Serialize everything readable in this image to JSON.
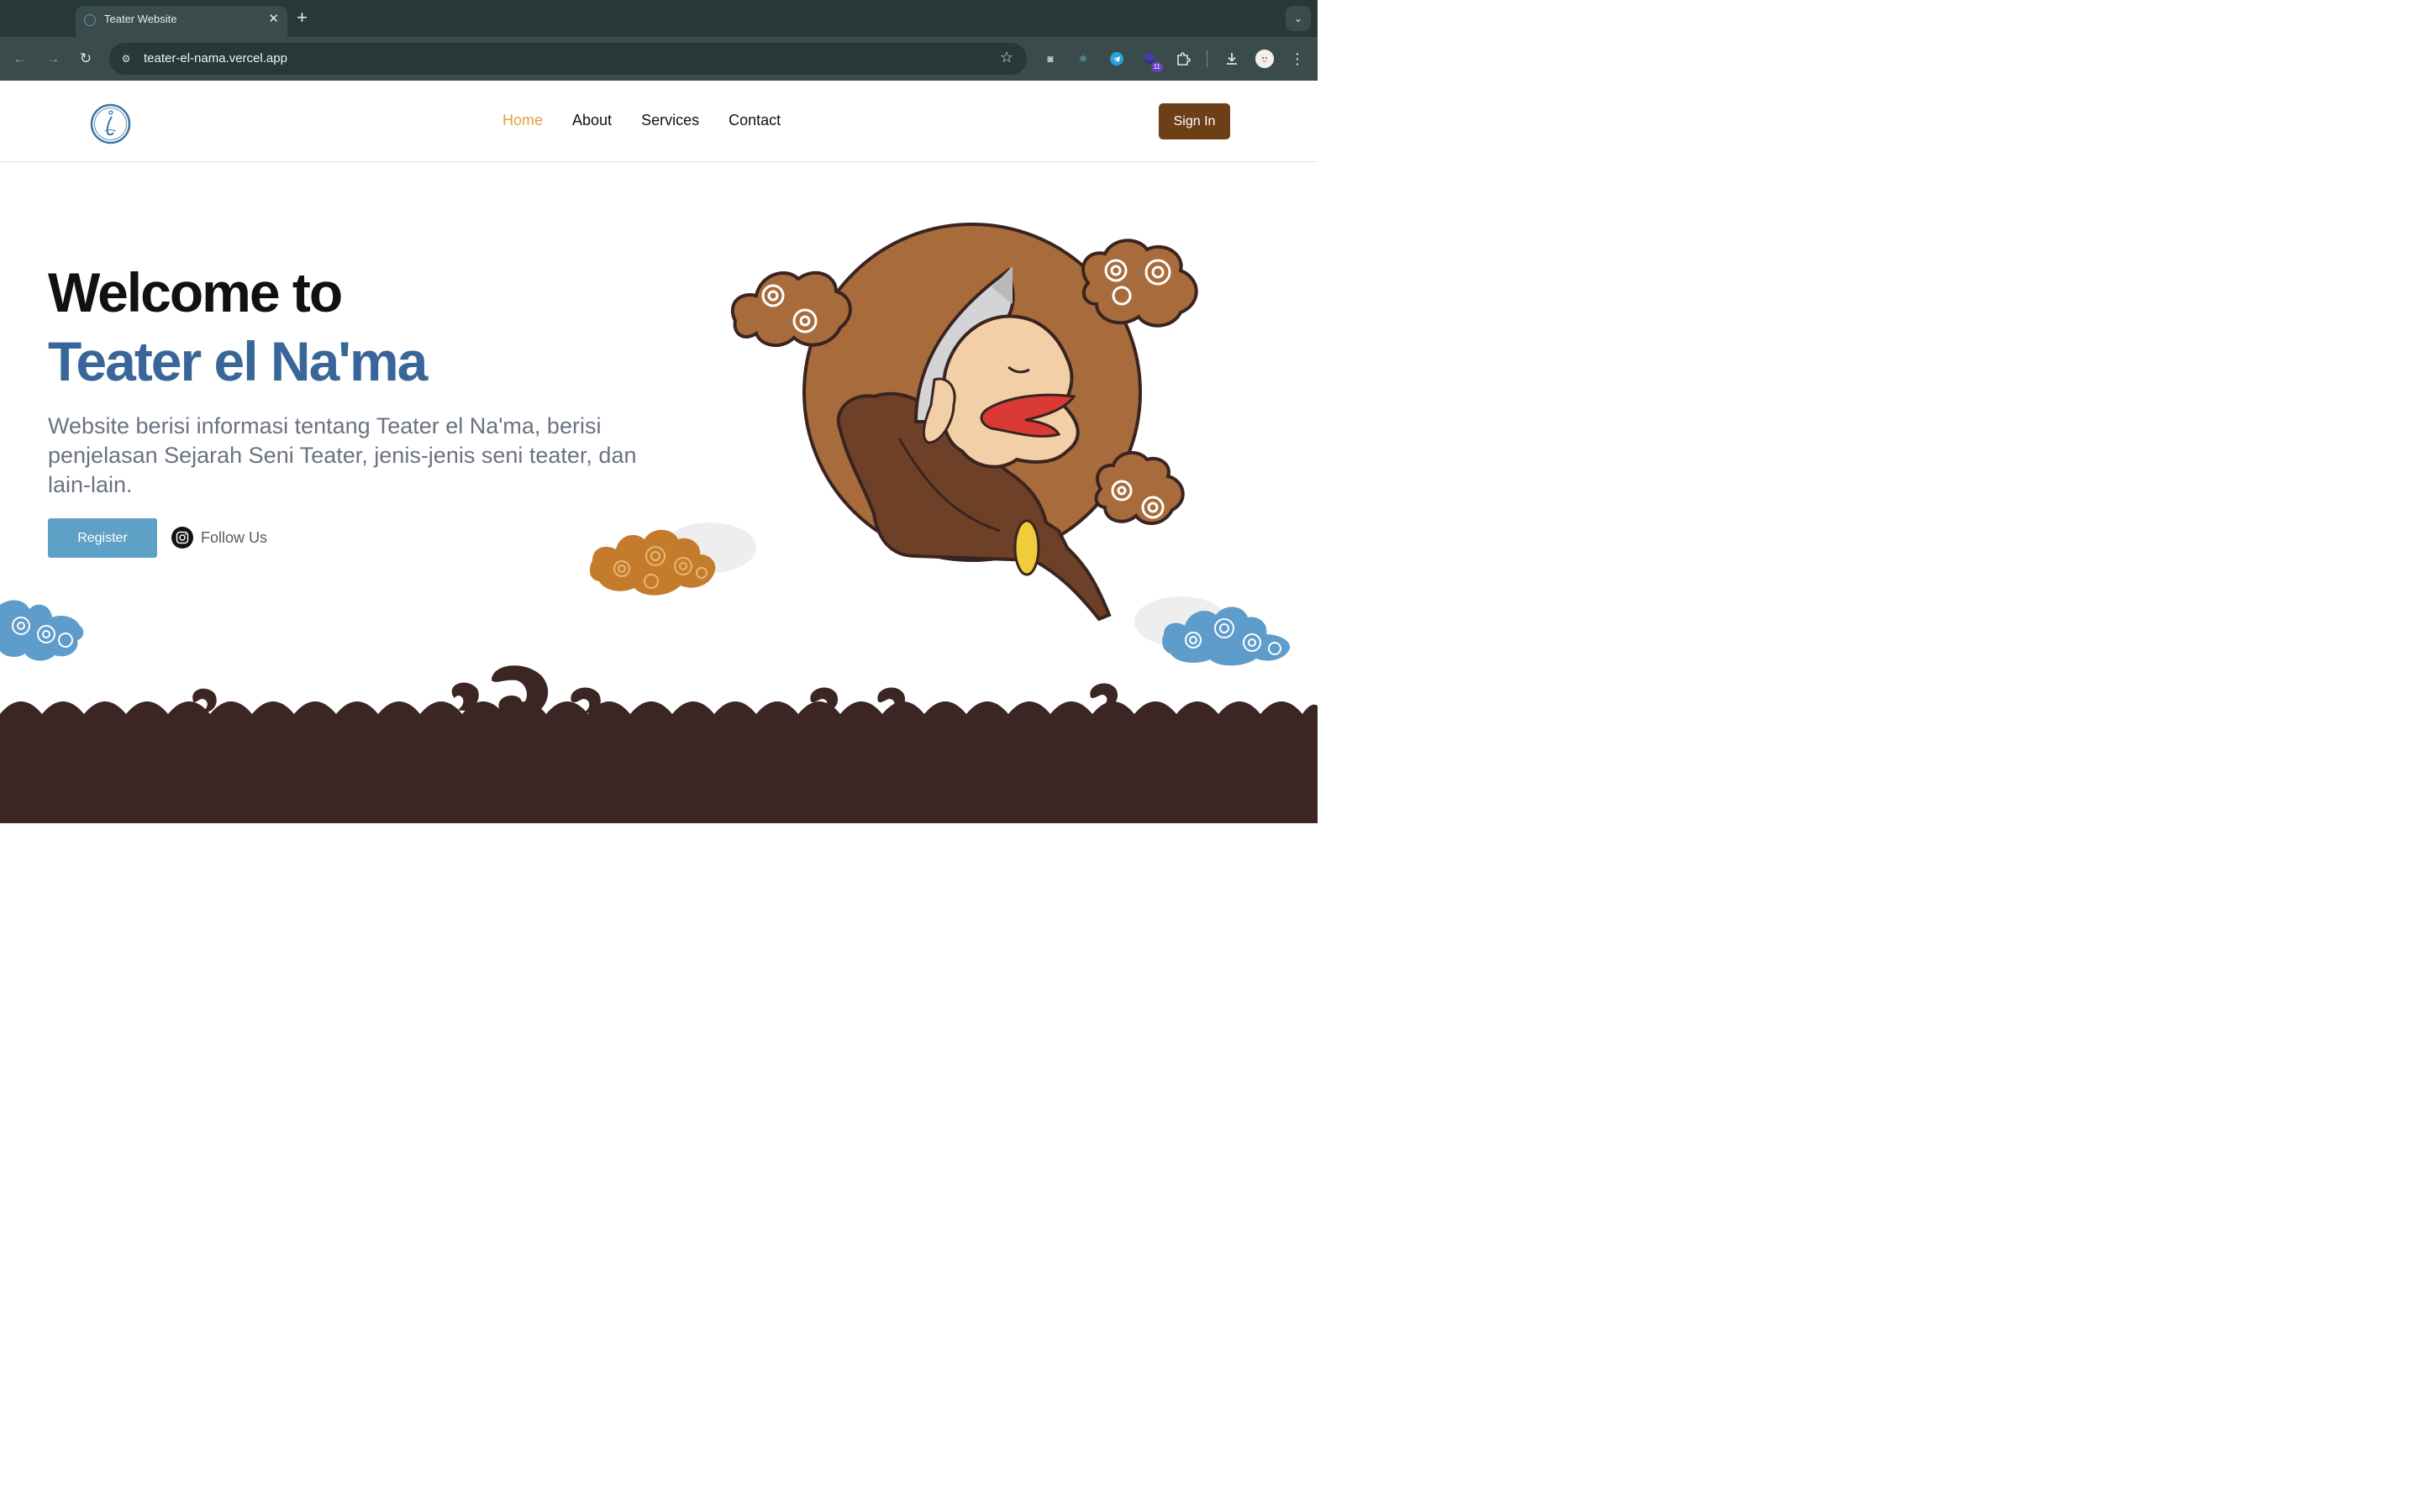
{
  "browser": {
    "tab_title": "Teater Website",
    "url": "teater-el-nama.vercel.app",
    "extension_badge": "11"
  },
  "header": {
    "nav": [
      "Home",
      "About",
      "Services",
      "Contact"
    ],
    "active_nav": "Home",
    "sign_in_label": "Sign In"
  },
  "hero": {
    "title_line1": "Welcome to",
    "title_line2": "Teater el Na'ma",
    "description": "Website berisi informasi tentang Teater el Na'ma, berisi penjelasan Sejarah Seni Teater, jenis-jenis seni teater, dan lain-lain.",
    "register_label": "Register",
    "follow_label": "Follow Us"
  },
  "colors": {
    "accent_blue": "#396699",
    "nav_active": "#e0a13a",
    "sign_in_bg": "#6d3f16",
    "register_bg": "#5fa0c7",
    "footer_brown": "#3b2624",
    "chrome_dark": "#273838"
  },
  "icons": {
    "logo": "teater-logo-icon",
    "follow": "instagram-icon",
    "illustration": "wayang-character-illustration"
  }
}
